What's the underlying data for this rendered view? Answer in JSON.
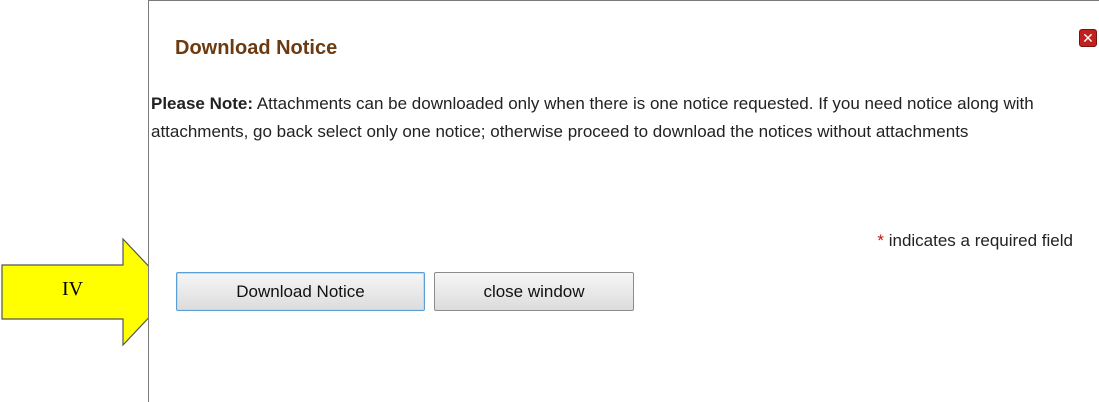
{
  "dialog": {
    "title": "Download Notice",
    "close_icon": "close-icon",
    "note_label": "Please Note:",
    "note_text": " Attachments can be downloaded only when there is one notice requested. If you need notice along with attachments, go back select only one notice; otherwise proceed to download the notices without attachments",
    "required_star": "*",
    "required_text": " indicates a required field",
    "download_button_label": "Download Notice",
    "close_button_label": "close window"
  },
  "annotation": {
    "arrow_label": "IV",
    "arrow_color": "#ffff00"
  },
  "colors": {
    "title": "#6b3a10",
    "close_icon_bg": "#c0201e",
    "required_star": "#d01010"
  }
}
